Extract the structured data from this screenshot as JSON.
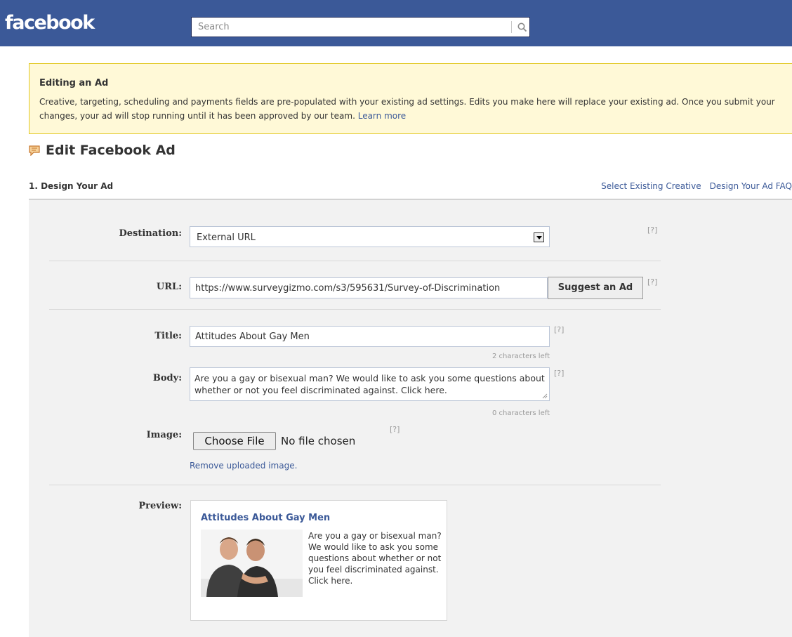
{
  "header": {
    "logo": "facebook",
    "search_placeholder": "Search"
  },
  "notice": {
    "title": "Editing an Ad",
    "text": "Creative, targeting, scheduling and payments fields are pre-populated with your existing ad settings. Edits you make here will replace your existing ad. Once you submit your changes, your ad will stop running until it has been approved by our team.",
    "link": "Learn more"
  },
  "page": {
    "title": "Edit Facebook Ad"
  },
  "section": {
    "heading": "1. Design Your Ad",
    "links": [
      "Select Existing Creative",
      "Design Your Ad FAQ"
    ]
  },
  "form": {
    "help": "[?]",
    "destination": {
      "label": "Destination:",
      "value": "External URL"
    },
    "url": {
      "label": "URL:",
      "value": "https://www.surveygizmo.com/s3/595631/Survey-of-Discrimination",
      "button": "Suggest an Ad"
    },
    "title": {
      "label": "Title:",
      "value": "Attitudes About Gay Men",
      "counter": "2 characters left"
    },
    "body": {
      "label": "Body:",
      "value": "Are you a gay or bisexual man? We would like to ask you some questions about whether or not you feel discriminated against. Click here.",
      "counter": "0 characters left"
    },
    "image": {
      "label": "Image:",
      "button": "Choose File",
      "status": "No file chosen",
      "remove_link": "Remove uploaded image."
    },
    "preview": {
      "label": "Preview:",
      "title": "Attitudes About Gay Men",
      "body": "Are you a gay or bisexual man? We would like to ask you some questions about whether or not you feel discriminated against. Click here."
    }
  },
  "colors": {
    "brand": "#3b5998",
    "notice_bg": "#fff9d7",
    "notice_border": "#e2c822",
    "panel_bg": "#f2f2f2"
  }
}
